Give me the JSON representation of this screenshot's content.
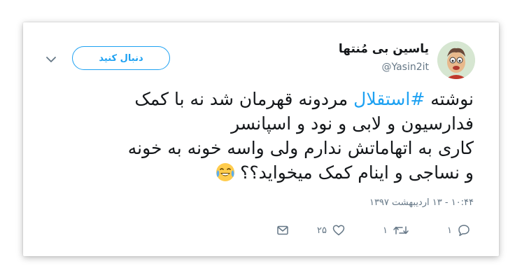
{
  "tweet": {
    "display_name": "یاسین بی مُنتها",
    "handle": "@Yasin2it",
    "follow_label": "دنبال کنید",
    "text_lines": [
      {
        "pre": "نوشته ",
        "hashtag": "#استقلال",
        "post": " مردونه قهرمان شد نه با کمک"
      },
      {
        "text": "فدارسیون و لابی و نود و اسپانسر"
      },
      {
        "text": "کاری به اتهاماتش ندارم ولی واسه خونه به خونه"
      },
      {
        "text": "و نساجی و اینام کمک میخواید؟؟"
      }
    ],
    "emoji_icon": "face-with-tears-of-joy-icon",
    "timestamp": "۱۰:۴۴ - ۱۳ اردیبهشت ۱۳۹۷",
    "actions": {
      "reply_count": "۱",
      "retweet_count": "۱",
      "like_count": "۲۵"
    }
  },
  "colors": {
    "accent": "#1da1f2",
    "text": "#14171a",
    "muted": "#657786"
  }
}
